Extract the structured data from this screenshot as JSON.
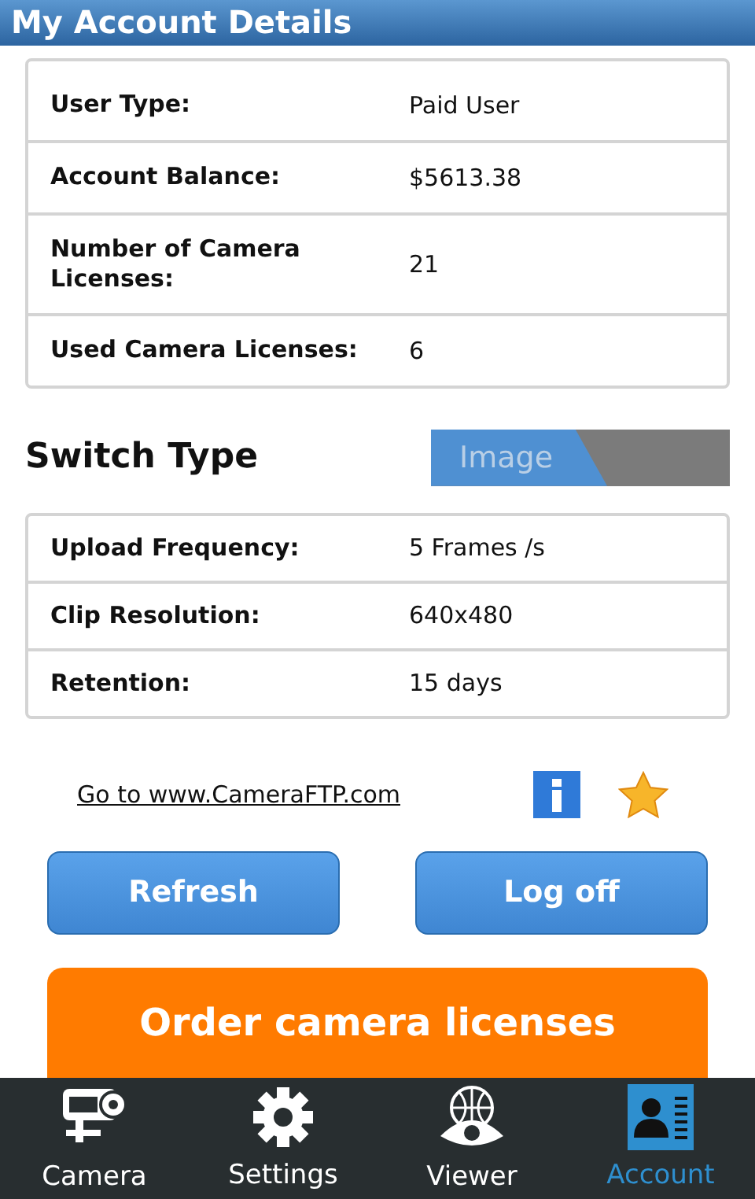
{
  "title": "My Account Details",
  "account_rows": [
    {
      "label": "User Type:",
      "value": "Paid User"
    },
    {
      "label": "Account Balance:",
      "value": "$5613.38"
    },
    {
      "label": "Number of Camera Licenses:",
      "value": "21"
    },
    {
      "label": "Used Camera Licenses:",
      "value": "6"
    }
  ],
  "switch": {
    "label": "Switch Type",
    "option": "Image",
    "on": false
  },
  "settings_rows": [
    {
      "label": "Upload Frequency:",
      "value": "5 Frames /s"
    },
    {
      "label": "Clip Resolution:",
      "value": "640x480"
    },
    {
      "label": "Retention:",
      "value": "15 days"
    }
  ],
  "link": "Go to www.CameraFTP.com",
  "buttons": [
    "Refresh",
    "Log off"
  ],
  "order_button": "Order camera licenses",
  "tabs": [
    {
      "label": "Camera",
      "kind": "camera",
      "selected": false
    },
    {
      "label": "Settings",
      "kind": "gear",
      "selected": false
    },
    {
      "label": "Viewer",
      "kind": "eye",
      "selected": false
    },
    {
      "label": "Account",
      "kind": "contact",
      "selected": true
    }
  ]
}
